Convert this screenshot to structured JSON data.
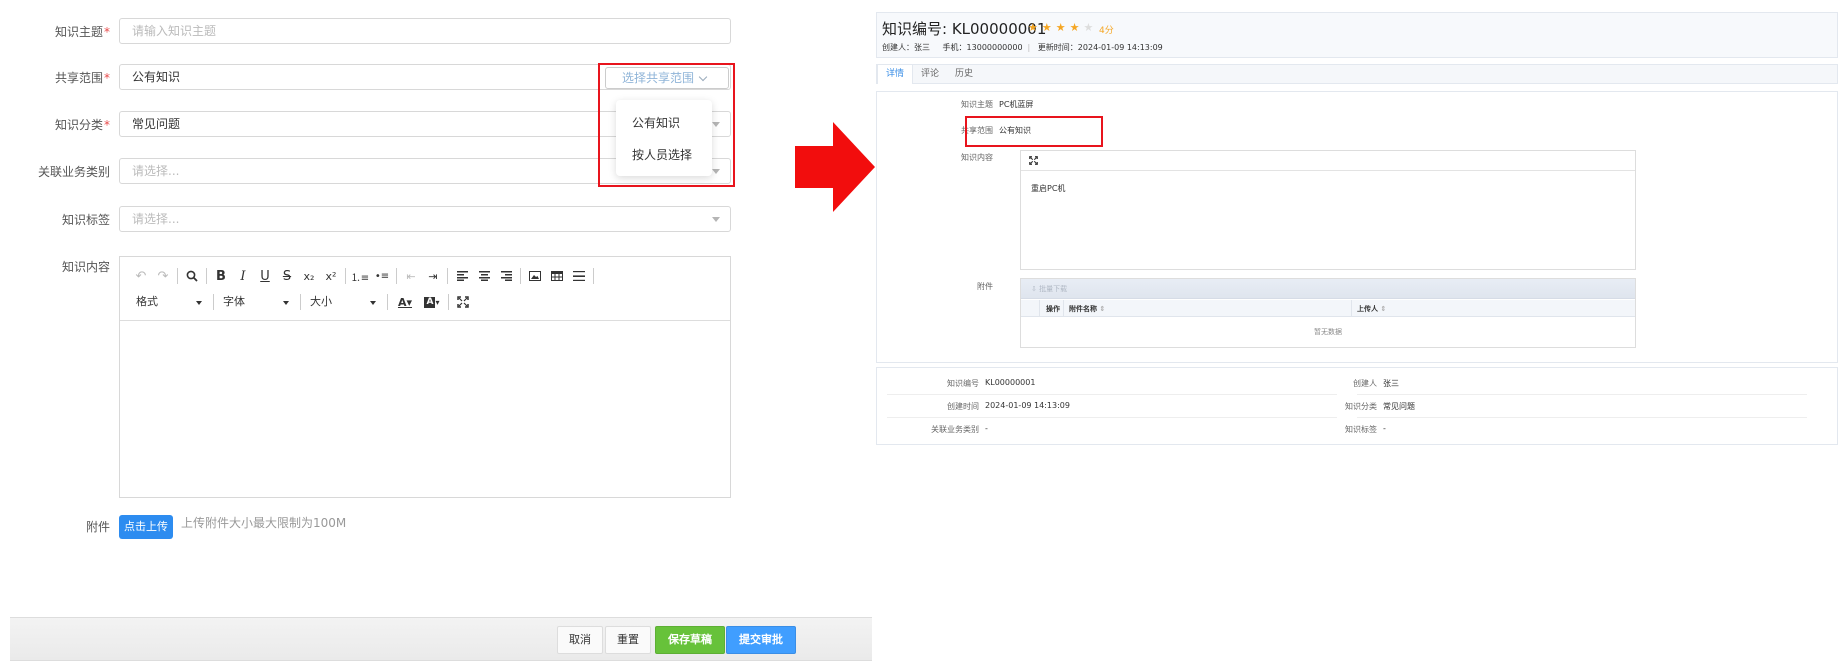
{
  "form": {
    "fields": {
      "topic": {
        "label": "知识主题",
        "required_mark": "*",
        "placeholder": "请输入知识主题"
      },
      "scope": {
        "label": "共享范围",
        "required_mark": "*",
        "value": "公有知识",
        "select_button": "选择共享范围"
      },
      "category": {
        "label": "知识分类",
        "required_mark": "*",
        "value": "常见问题"
      },
      "business": {
        "label": "关联业务类别",
        "placeholder": "请选择..."
      },
      "tags": {
        "label": "知识标签",
        "placeholder": "请选择..."
      },
      "content": {
        "label": "知识内容"
      },
      "attachment": {
        "label": "附件",
        "upload_button": "点击上传",
        "hint": "上传附件大小最大限制为100M"
      }
    },
    "scope_dropdown": [
      "公有知识",
      "按人员选择"
    ],
    "editor": {
      "format_label": "格式",
      "font_label": "字体",
      "size_label": "大小"
    },
    "footer": {
      "cancel": "取消",
      "reset": "重置",
      "save_draft": "保存草稿",
      "submit": "提交审批"
    },
    "colors": {
      "accent": "#2d8cf0",
      "save": "#67c23a",
      "submit": "#409eff",
      "highlight": "#e8141d"
    }
  },
  "detail": {
    "title": "知识编号: KL00000001",
    "rating": {
      "stars": 4,
      "max": 5,
      "score_text": "4分"
    },
    "meta": {
      "creator": "创建人：张三",
      "phone": "手机：13000000000",
      "updated": "更新时间：2024-01-09 14:13:09"
    },
    "tabs": [
      "详情",
      "评论",
      "历史"
    ],
    "rows": {
      "topic": {
        "label": "知识主题",
        "value": "PC机蓝屏"
      },
      "scope": {
        "label": "共享范围",
        "value": "公有知识"
      },
      "content": {
        "label": "知识内容",
        "value": "重启PC机"
      },
      "attachment": {
        "label": "附件"
      }
    },
    "attachment_table": {
      "toolbar_button": "批量下载",
      "headers": [
        "操作",
        "附件名称",
        "上传人"
      ],
      "empty_text": "暂无数据"
    },
    "info": {
      "code": {
        "label": "知识编号",
        "value": "KL00000001"
      },
      "creator": {
        "label": "创建人",
        "value": "张三"
      },
      "created": {
        "label": "创建时间",
        "value": "2024-01-09 14:13:09"
      },
      "category": {
        "label": "知识分类",
        "value": "常见问题"
      },
      "business": {
        "label": "关联业务类别",
        "value": "-"
      },
      "tags": {
        "label": "知识标签",
        "value": "-"
      }
    }
  }
}
